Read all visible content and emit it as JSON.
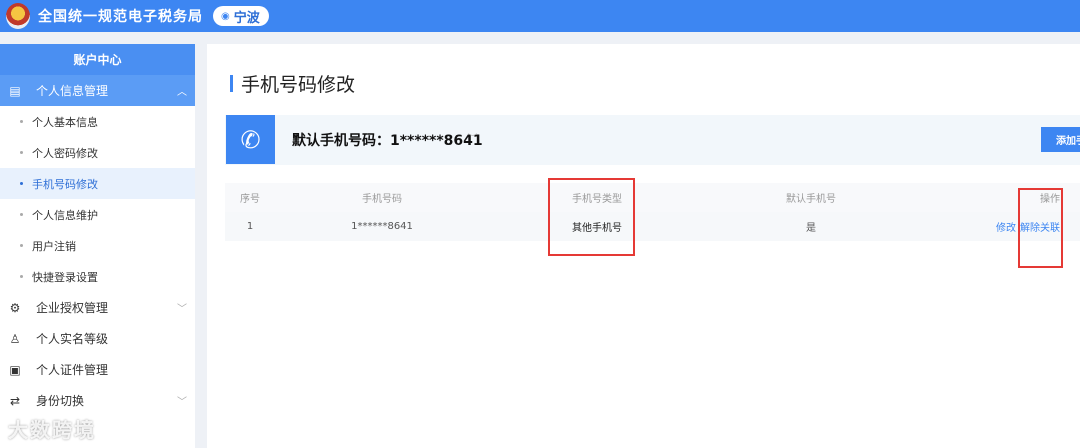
{
  "header": {
    "title": "全国统一规范电子税务局",
    "city": "宁波"
  },
  "sidebar": {
    "title": "账户中心",
    "groups": [
      {
        "label": "个人信息管理",
        "icon": "profile-icon"
      },
      {
        "label": "企业授权管理",
        "icon": "badge-check-icon"
      },
      {
        "label": "个人实名等级",
        "icon": "user-icon"
      },
      {
        "label": "个人证件管理",
        "icon": "id-card-icon"
      },
      {
        "label": "身份切换",
        "icon": "switch-icon"
      }
    ],
    "sub_items": [
      "个人基本信息",
      "个人密码修改",
      "手机号码修改",
      "个人信息维护",
      "用户注销",
      "快捷登录设置"
    ]
  },
  "main": {
    "title": "手机号码修改",
    "default_phone_label": "默认手机号码：1******8641",
    "add_button": "添加手机号",
    "table": {
      "headers": [
        "序号",
        "手机号码",
        "手机号类型",
        "默认手机号",
        "操作"
      ],
      "rows": [
        {
          "index": "1",
          "phone": "1******8641",
          "type": "其他手机号",
          "is_default": "是",
          "actions": [
            "修改",
            "解除关联"
          ]
        }
      ]
    }
  },
  "watermark": "大数跨境",
  "colors": {
    "primary": "#3d86f2",
    "highlight": "#e53935"
  }
}
